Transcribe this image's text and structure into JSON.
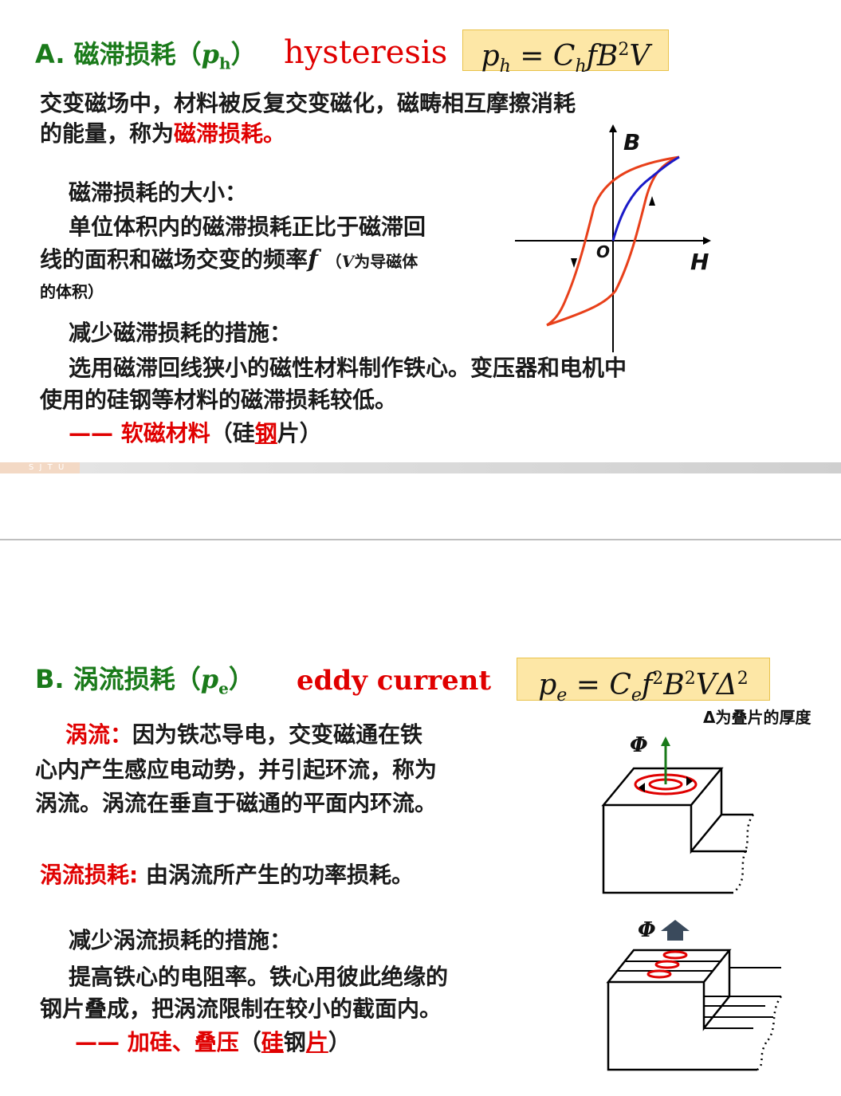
{
  "slide1": {
    "heading": {
      "prefix": "A. 磁滞损耗（",
      "symbol_main": "p",
      "symbol_sub": "h",
      "suffix": "）",
      "english": "hysteresis"
    },
    "formula": {
      "lhs": "p",
      "lhs_sub": "h",
      "eq": " = ",
      "c": "C",
      "c_sub": "h",
      "rest": "fB",
      "exp": "2",
      "tail": "V"
    },
    "intro_line1": "交变磁场中，材料被反复交变磁化，磁畴相互摩擦消耗",
    "intro_line2_a": "的能量，称为",
    "intro_line2_b": "磁滞损耗。",
    "size_title": "磁滞损耗的大小：",
    "size_line1": "单位体积内的磁滞损耗正比于磁滞回",
    "size_line2_a": "线的面积和磁场交变的频率",
    "size_line2_f": "f",
    "size_note_a": "（",
    "size_note_v": "V",
    "size_note_b": "为导磁体",
    "size_note_line2": "的体积）",
    "reduce_title": "减少磁滞损耗的措施：",
    "reduce_line1": "选用磁滞回线狭小的磁性材料制作铁心。变压器和电机中",
    "reduce_line2": "使用的硅钢等材料的磁滞损耗较低。",
    "conclusion": {
      "dash": "—— ",
      "red": "软磁材料",
      "paren_open": "（硅",
      "red_underlined": "钢",
      "rest": "片）"
    },
    "diagram": {
      "b_label": "B",
      "h_label": "H",
      "o_label": "O"
    },
    "footer": "S J T U"
  },
  "slide2": {
    "heading": {
      "prefix": "B. 涡流损耗（",
      "symbol_main": "p",
      "symbol_sub": "e",
      "suffix": "）",
      "english": "eddy current"
    },
    "formula": {
      "lhs": "p",
      "lhs_sub": "e",
      "eq": " = ",
      "c": "C",
      "c_sub": "e",
      "f": "f",
      "f_exp": "2",
      "b": "B",
      "b_exp": "2",
      "v": "VΔ",
      "d_exp": "2"
    },
    "delta_note": "Δ为叠片的厚度",
    "eddy_label": "涡流：",
    "eddy_line1": "因为铁芯导电，交变磁通在铁",
    "eddy_line2": "心内产生感应电动势，并引起环流，称为",
    "eddy_line3": "涡流。涡流在垂直于磁通的平面内环流。",
    "loss_label": "涡流损耗:",
    "loss_text": " 由涡流所产生的功率损耗。",
    "reduce_title": "减少涡流损耗的措施：",
    "reduce_line1": "提高铁心的电阻率。铁心用彼此绝缘的",
    "reduce_line2": "钢片叠成，把涡流限制在较小的截面内。",
    "conclusion": {
      "dash": "—— ",
      "red": "加硅、叠压",
      "p_open": "（",
      "red2": "硅",
      "mid": "钢",
      "red3": "片",
      "p_close": "）"
    },
    "phi_label": "Φ"
  },
  "colors": {
    "green": "#1a7a1a",
    "red": "#e00000",
    "navy": "#1c1c9c",
    "formula_bg": "#fde7a6",
    "curve_red": "#e8401a",
    "curve_blue": "#1a1ac8"
  }
}
